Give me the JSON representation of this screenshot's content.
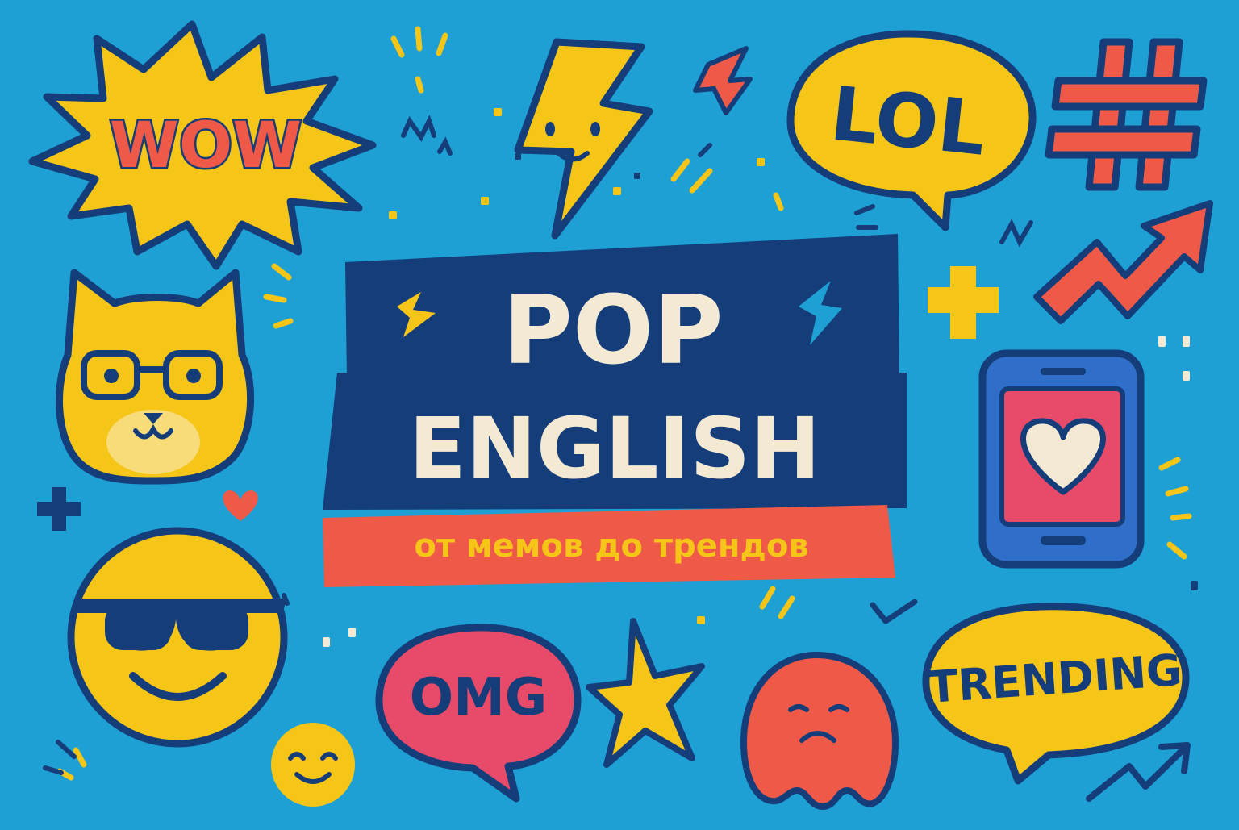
{
  "colors": {
    "background": "#1ea0d4",
    "navy": "#143d7a",
    "yellow": "#f5c518",
    "red": "#ef5a48",
    "pink": "#e84a6a",
    "cream": "#f4e9d3",
    "phone_blue": "#2f6fc9"
  },
  "title": {
    "line1": "POP",
    "line2": "ENGLISH",
    "subtitle": "от мемов до трендов"
  },
  "stickers": {
    "wow": "WOW",
    "lol": "LOL",
    "omg": "OMG",
    "trending": "TRENDING"
  },
  "icons": [
    "starburst-icon",
    "lightning-bolt-face-icon",
    "speech-bubble-icon",
    "hashtag-icon",
    "trending-arrow-icon",
    "cat-with-glasses-icon",
    "sunglasses-smiley-icon",
    "small-smiley-icon",
    "smartphone-heart-icon",
    "star-icon",
    "sad-blob-icon",
    "heart-icon",
    "plus-icon"
  ]
}
